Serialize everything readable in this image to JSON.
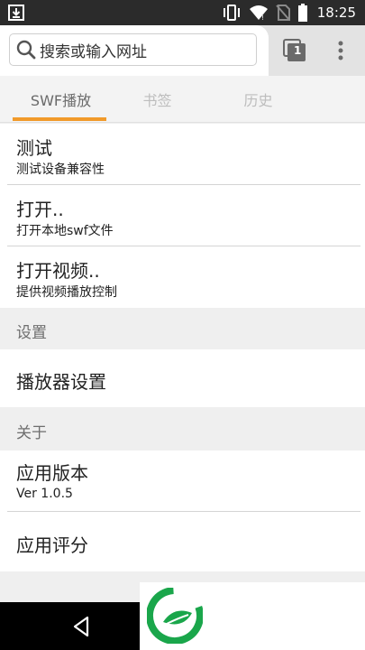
{
  "status_bar": {
    "time": "18:25",
    "icons": [
      "download-icon",
      "vibrate-icon",
      "wifi-icon",
      "no-sim-icon",
      "battery-icon"
    ]
  },
  "toolbar": {
    "search_placeholder": "搜索或输入网址",
    "tab_count": "1"
  },
  "tabs": [
    {
      "label": "SWF播放",
      "active": true
    },
    {
      "label": "书签",
      "active": false
    },
    {
      "label": "历史",
      "active": false
    }
  ],
  "items": {
    "test": {
      "title": "测试",
      "subtitle": "测试设备兼容性"
    },
    "open": {
      "title": "打开..",
      "subtitle": "打开本地swf文件"
    },
    "open_video": {
      "title": "打开视频..",
      "subtitle": "提供视频播放控制"
    }
  },
  "settings": {
    "header": "设置",
    "player_settings": "播放器设置"
  },
  "about": {
    "header": "关于",
    "version_title": "应用版本",
    "version_value": "Ver 1.0.5",
    "rate": "应用评分"
  },
  "colors": {
    "accent": "#f19a2a",
    "status_bar": "#2b2b2b",
    "logo_green": "#1aa64b"
  }
}
